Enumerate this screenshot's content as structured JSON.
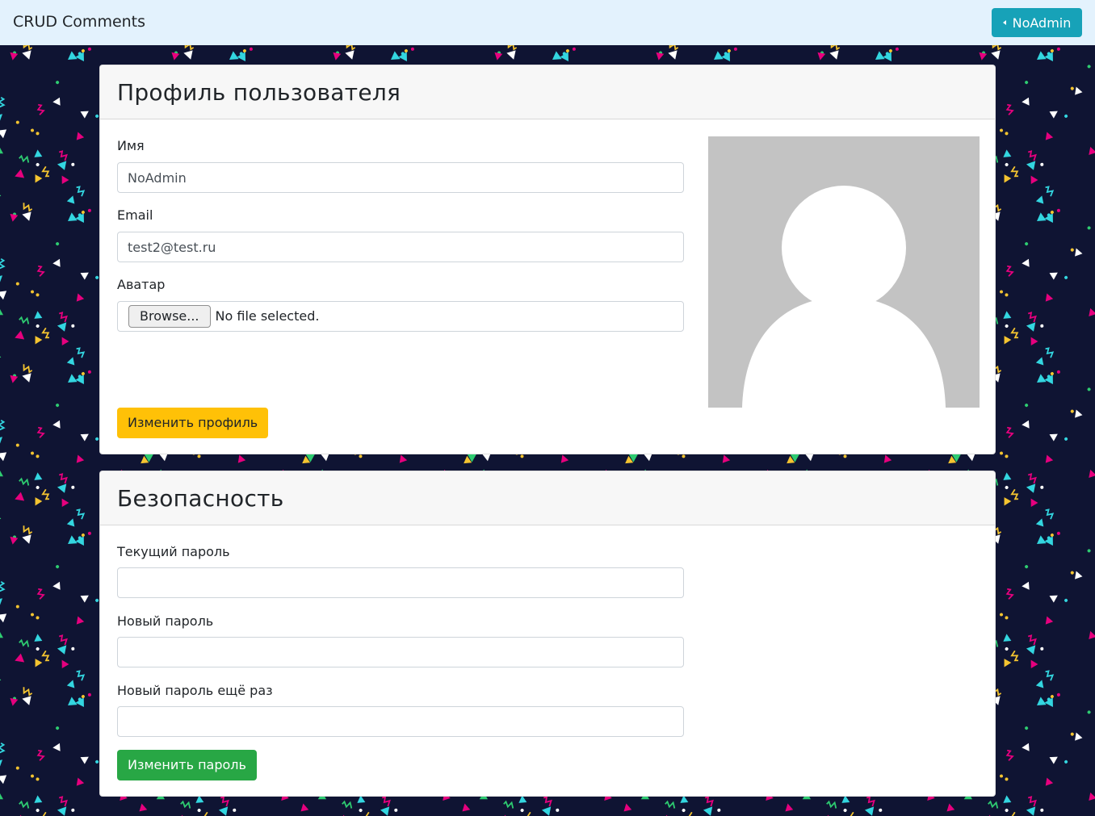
{
  "navbar": {
    "brand": "CRUD Comments",
    "user_button": "NoAdmin"
  },
  "profile": {
    "title": "Профиль пользователя",
    "name_label": "Имя",
    "name_value": "NoAdmin",
    "email_label": "Email",
    "email_value": "test2@test.ru",
    "avatar_label": "Аватар",
    "browse_label": "Browse...",
    "file_status": "No file selected.",
    "submit_label": "Изменить профиль",
    "avatar_image": "default-user-silhouette"
  },
  "security": {
    "title": "Безопасность",
    "current_password_label": "Текущий пароль",
    "current_password_value": "",
    "new_password_label": "Новый пароль",
    "new_password_value": "",
    "repeat_password_label": "Новый пароль ещё раз",
    "repeat_password_value": "",
    "submit_label": "Изменить пароль"
  },
  "colors": {
    "navbar_bg": "#e3f2fd",
    "page_bg": "#0f1433",
    "info_button": "#17a2b8",
    "warning_button": "#ffc107",
    "success_button": "#28a745",
    "avatar_bg": "#c3c3c3",
    "confetti": [
      "#f4c430",
      "#e6007e",
      "#33d6e0",
      "#2ecc71",
      "#ffffff"
    ]
  }
}
